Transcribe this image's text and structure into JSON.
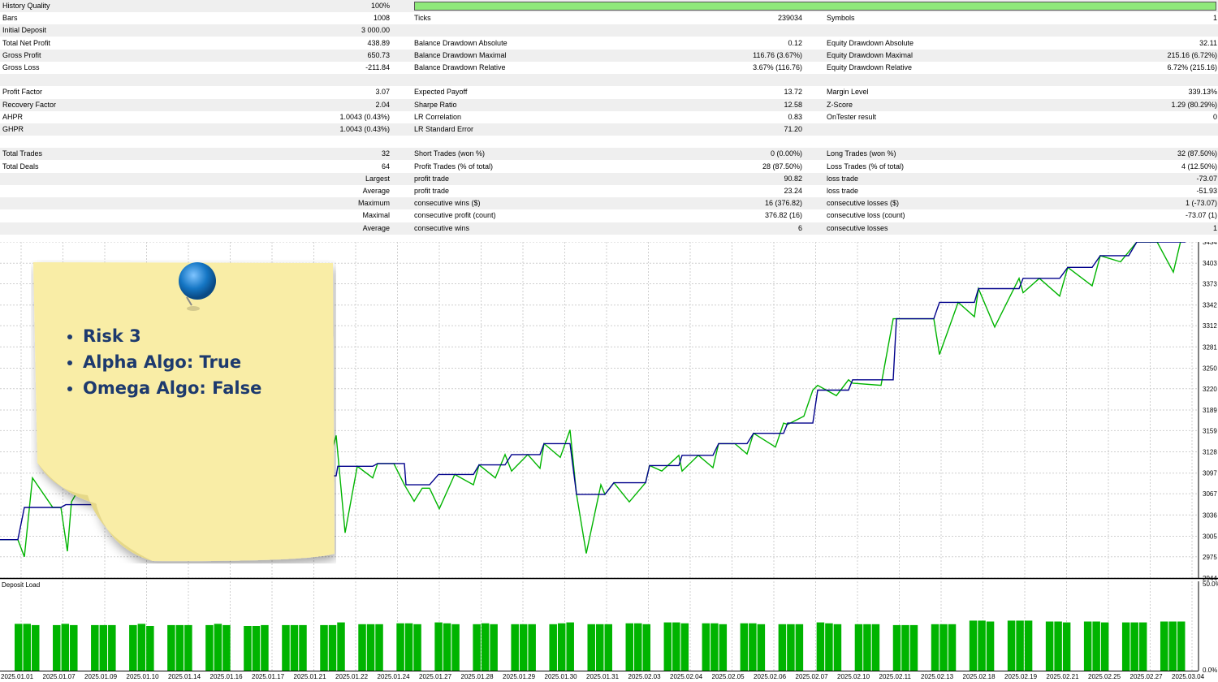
{
  "stats": {
    "history_quality": {
      "label": "History Quality",
      "value": "100%",
      "fraction": 1.0
    },
    "rows": [
      {
        "c1": [
          "Bars",
          "1008"
        ],
        "c2": [
          "Ticks",
          "239034"
        ],
        "c3": [
          "Symbols",
          "1"
        ]
      },
      {
        "c1": [
          "Initial Deposit",
          "3 000.00"
        ],
        "c2": [
          "",
          ""
        ],
        "c3": [
          "",
          ""
        ]
      },
      {
        "c1": [
          "Total Net Profit",
          "438.89"
        ],
        "c2": [
          "Balance Drawdown Absolute",
          "0.12"
        ],
        "c3": [
          "Equity Drawdown Absolute",
          "32.11"
        ]
      },
      {
        "c1": [
          "Gross Profit",
          "650.73"
        ],
        "c2": [
          "Balance Drawdown Maximal",
          "116.76 (3.67%)"
        ],
        "c3": [
          "Equity Drawdown Maximal",
          "215.16 (6.72%)"
        ]
      },
      {
        "c1": [
          "Gross Loss",
          "-211.84"
        ],
        "c2": [
          "Balance Drawdown Relative",
          "3.67% (116.76)"
        ],
        "c3": [
          "Equity Drawdown Relative",
          "6.72% (215.16)"
        ]
      },
      {
        "c1": [
          "",
          ""
        ],
        "c2": [
          "",
          ""
        ],
        "c3": [
          "",
          ""
        ]
      },
      {
        "c1": [
          "Profit Factor",
          "3.07"
        ],
        "c2": [
          "Expected Payoff",
          "13.72"
        ],
        "c3": [
          "Margin Level",
          "339.13%"
        ]
      },
      {
        "c1": [
          "Recovery Factor",
          "2.04"
        ],
        "c2": [
          "Sharpe Ratio",
          "12.58"
        ],
        "c3": [
          "Z-Score",
          "1.29 (80.29%)"
        ]
      },
      {
        "c1": [
          "AHPR",
          "1.0043 (0.43%)"
        ],
        "c2": [
          "LR Correlation",
          "0.83"
        ],
        "c3": [
          "OnTester result",
          "0"
        ]
      },
      {
        "c1": [
          "GHPR",
          "1.0043 (0.43%)"
        ],
        "c2": [
          "LR Standard Error",
          "71.20"
        ],
        "c3": [
          "",
          ""
        ]
      },
      {
        "c1": [
          "",
          ""
        ],
        "c2": [
          "",
          ""
        ],
        "c3": [
          "",
          ""
        ]
      },
      {
        "c1": [
          "Total Trades",
          "32"
        ],
        "c2": [
          "Short Trades (won %)",
          "0 (0.00%)"
        ],
        "c3": [
          "Long Trades (won %)",
          "32 (87.50%)"
        ]
      },
      {
        "c1": [
          "Total Deals",
          "64"
        ],
        "c2": [
          "Profit Trades (% of total)",
          "28 (87.50%)"
        ],
        "c3": [
          "Loss Trades (% of total)",
          "4 (12.50%)"
        ]
      },
      {
        "c1": [
          "",
          "Largest"
        ],
        "c2": [
          "profit trade",
          "90.82"
        ],
        "c3": [
          "loss trade",
          "-73.07"
        ]
      },
      {
        "c1": [
          "",
          "Average"
        ],
        "c2": [
          "profit trade",
          "23.24"
        ],
        "c3": [
          "loss trade",
          "-51.93"
        ]
      },
      {
        "c1": [
          "",
          "Maximum"
        ],
        "c2": [
          "consecutive wins ($)",
          "16 (376.82)"
        ],
        "c3": [
          "consecutive losses ($)",
          "1 (-73.07)"
        ]
      },
      {
        "c1": [
          "",
          "Maximal"
        ],
        "c2": [
          "consecutive profit (count)",
          "376.82 (16)"
        ],
        "c3": [
          "consecutive loss (count)",
          "-73.07 (1)"
        ]
      },
      {
        "c1": [
          "",
          "Average"
        ],
        "c2": [
          "consecutive wins",
          "6"
        ],
        "c3": [
          "consecutive losses",
          "1"
        ]
      }
    ]
  },
  "note": {
    "items": [
      "Risk 3",
      "Alpha Algo: True",
      "Omega Algo: False"
    ],
    "text_color": "#1d3a6e",
    "paper_color": "#f9eda6",
    "pin_color": "#1576c4"
  },
  "chart_data": [
    {
      "type": "line",
      "title": "",
      "y_ticks": [
        "2944",
        "2975",
        "3005",
        "3036",
        "3067",
        "3097",
        "3128",
        "3159",
        "3189",
        "3220",
        "3250",
        "3281",
        "3312",
        "3342",
        "3373",
        "3403",
        "3434"
      ],
      "ylim": [
        2944,
        3434
      ],
      "grid": true,
      "series": [
        {
          "color": "#00008b",
          "x": [
            0,
            22,
            30,
            75,
            81,
            140,
            192,
            219,
            279,
            284,
            308,
            345,
            353,
            414,
            416,
            459,
            465,
            498,
            500,
            529,
            540,
            583,
            590,
            622,
            630,
            665,
            670,
            702,
            710,
            745,
            756,
            795,
            800,
            836,
            840,
            878,
            885,
            920,
            928,
            965,
            970,
            1001,
            1007,
            1045,
            1050,
            1100,
            1104,
            1150,
            1157,
            1200,
            1205,
            1255,
            1260,
            1305,
            1315,
            1345,
            1355,
            1390,
            1400,
            1460
          ],
          "y": [
            3000,
            3000,
            3047,
            3047,
            3051,
            3051,
            3047,
            3047,
            3047,
            3065,
            3065,
            3065,
            3093,
            3093,
            3107,
            3107,
            3111,
            3111,
            3080,
            3080,
            3095,
            3095,
            3109,
            3109,
            3124,
            3124,
            3140,
            3140,
            3066,
            3066,
            3083,
            3083,
            3108,
            3108,
            3123,
            3123,
            3140,
            3140,
            3155,
            3155,
            3170,
            3170,
            3218,
            3218,
            3233,
            3233,
            3322,
            3322,
            3346,
            3346,
            3366,
            3366,
            3381,
            3381,
            3397,
            3397,
            3414,
            3414,
            3434,
            3434
          ]
        },
        {
          "color": "#00b400",
          "x": [
            0,
            22,
            30,
            40,
            65,
            75,
            83,
            88,
            100,
            125,
            140,
            165,
            175,
            200,
            219,
            279,
            284,
            300,
            330,
            345,
            353,
            400,
            414,
            425,
            440,
            459,
            465,
            485,
            498,
            510,
            520,
            529,
            541,
            560,
            583,
            590,
            610,
            622,
            630,
            650,
            665,
            670,
            690,
            702,
            710,
            722,
            740,
            745,
            756,
            775,
            795,
            800,
            815,
            836,
            840,
            860,
            878,
            885,
            905,
            920,
            928,
            955,
            965,
            970,
            990,
            1001,
            1007,
            1030,
            1045,
            1050,
            1085,
            1100,
            1104,
            1150,
            1157,
            1180,
            1200,
            1205,
            1225,
            1255,
            1260,
            1280,
            1305,
            1315,
            1345,
            1355,
            1380,
            1400,
            1425,
            1445,
            1455
          ],
          "y": [
            3000,
            3000,
            2975,
            3090,
            3047,
            3047,
            2983,
            3055,
            3080,
            3060,
            3051,
            3085,
            3060,
            3070,
            3047,
            3047,
            3065,
            3065,
            3075,
            3065,
            3093,
            3090,
            3152,
            3010,
            3107,
            3090,
            3111,
            3111,
            3080,
            3056,
            3075,
            3075,
            3045,
            3095,
            3080,
            3109,
            3090,
            3124,
            3100,
            3124,
            3104,
            3140,
            3120,
            3160,
            3066,
            2980,
            3080,
            3066,
            3083,
            3055,
            3083,
            3108,
            3100,
            3123,
            3100,
            3123,
            3105,
            3140,
            3140,
            3125,
            3155,
            3135,
            3170,
            3168,
            3180,
            3218,
            3225,
            3210,
            3233,
            3228,
            3225,
            3322,
            3322,
            3322,
            3270,
            3346,
            3325,
            3366,
            3310,
            3381,
            3360,
            3381,
            3355,
            3397,
            3370,
            3414,
            3405,
            3434,
            3434,
            3390,
            3440
          ]
        }
      ]
    },
    {
      "type": "bar",
      "title": "Deposit Load",
      "y_ticks": [
        "50.0%",
        "0.0%"
      ],
      "ylim": [
        0,
        50
      ],
      "categories": [
        "2025.01.01",
        "2025.01.07",
        "2025.01.09",
        "2025.01.10",
        "2025.01.14",
        "2025.01.16",
        "2025.01.17",
        "2025.01.21",
        "2025.01.22",
        "2025.01.24",
        "2025.01.27",
        "2025.01.28",
        "2025.01.29",
        "2025.01.30",
        "2025.01.31",
        "2025.02.03",
        "2025.02.04",
        "2025.02.05",
        "2025.02.06",
        "2025.02.07",
        "2025.02.10",
        "2025.02.11",
        "2025.02.13",
        "2025.02.18",
        "2025.02.19",
        "2025.02.21",
        "2025.02.25",
        "2025.02.27",
        "2025.03.04"
      ],
      "bar_groups": [
        [
          26.2,
          26.2,
          25.5
        ],
        [
          25.5,
          26.2,
          25.5
        ],
        [
          25.5,
          25.5,
          25.5
        ],
        [
          25.5,
          26.2,
          25.0
        ],
        [
          25.5,
          25.5,
          25.5
        ],
        [
          25.5,
          26.2,
          25.5
        ],
        [
          25.0,
          25.0,
          25.5
        ],
        [
          25.5,
          25.5,
          25.5
        ],
        [
          25.5,
          25.5,
          27.0
        ],
        [
          26.0,
          26.0,
          26.0
        ],
        [
          26.5,
          26.5,
          26.0
        ],
        [
          27.0,
          26.5,
          26.0
        ],
        [
          26.0,
          26.5,
          26.0
        ],
        [
          26.0,
          26.0,
          26.0
        ],
        [
          26.0,
          26.5,
          27.0
        ],
        [
          26.0,
          26.0,
          26.0
        ],
        [
          26.5,
          26.5,
          26.0
        ],
        [
          27.0,
          27.0,
          26.5
        ],
        [
          26.5,
          26.5,
          26.0
        ],
        [
          26.5,
          26.5,
          26.0
        ],
        [
          26.0,
          26.0,
          26.0
        ],
        [
          27.0,
          26.5,
          26.0
        ],
        [
          26.0,
          26.0,
          26.0
        ],
        [
          25.5,
          25.5,
          25.5
        ],
        [
          26.0,
          26.0,
          26.0
        ],
        [
          28.0,
          28.0,
          27.5
        ],
        [
          28.0,
          28.0,
          28.0
        ],
        [
          27.5,
          27.5,
          27.0
        ],
        [
          27.5,
          27.5,
          27.0
        ],
        [
          27.0,
          27.0,
          27.0
        ],
        [
          27.5,
          27.5,
          27.5
        ]
      ]
    }
  ]
}
